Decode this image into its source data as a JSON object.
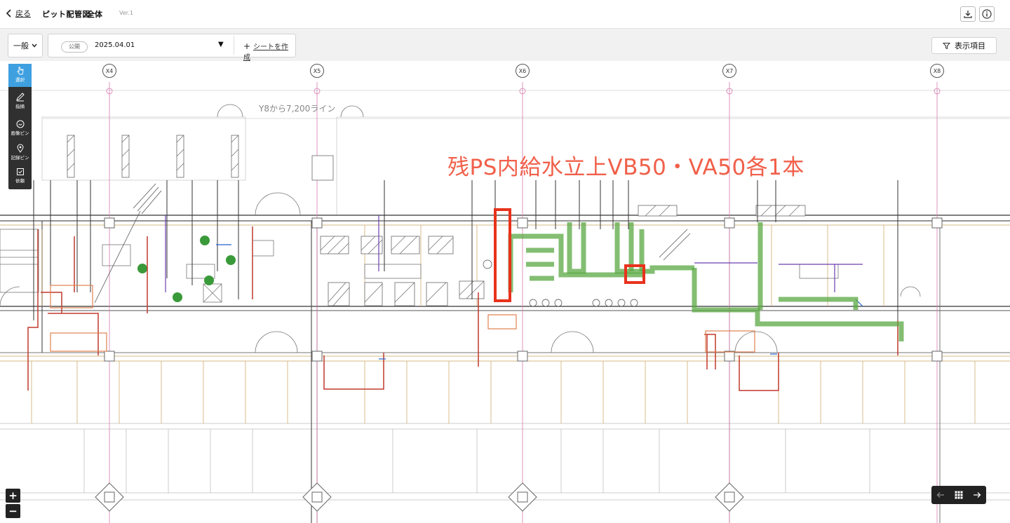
{
  "header": {
    "back_label": "戻る",
    "title": "ピット配管図",
    "title_suffix": "全体",
    "version": "Ver.1"
  },
  "subbar": {
    "category_label": "一般",
    "sheet_tag": "公開",
    "sheet_date": "2025.04.01",
    "create_sheet_label": "シートを作成",
    "display_items_label": "表示項目"
  },
  "tools": [
    {
      "label": "選択",
      "icon": "pointer-icon",
      "active": true
    },
    {
      "label": "指摘",
      "icon": "pen-icon",
      "active": false
    },
    {
      "label": "画像ピン",
      "icon": "image-pin-icon",
      "active": false
    },
    {
      "label": "記録ピン",
      "icon": "location-pin-icon",
      "active": false
    },
    {
      "label": "依頼",
      "icon": "checkbox-icon",
      "active": false
    }
  ],
  "zoom": {
    "in": "+",
    "out": "−"
  },
  "drawing": {
    "columns": [
      "X4",
      "X5",
      "X6",
      "X7",
      "X8"
    ],
    "grid_label": "Y8から7,200ライン",
    "annotation": "残PS内給水立上VB50・VA50各1本"
  },
  "colors": {
    "accent": "#3fa0e0",
    "annotation": "#f0604a",
    "highlight_box": "#e8321c",
    "pipe_green": "#5aa843",
    "pipe_red": "#c0392b"
  }
}
